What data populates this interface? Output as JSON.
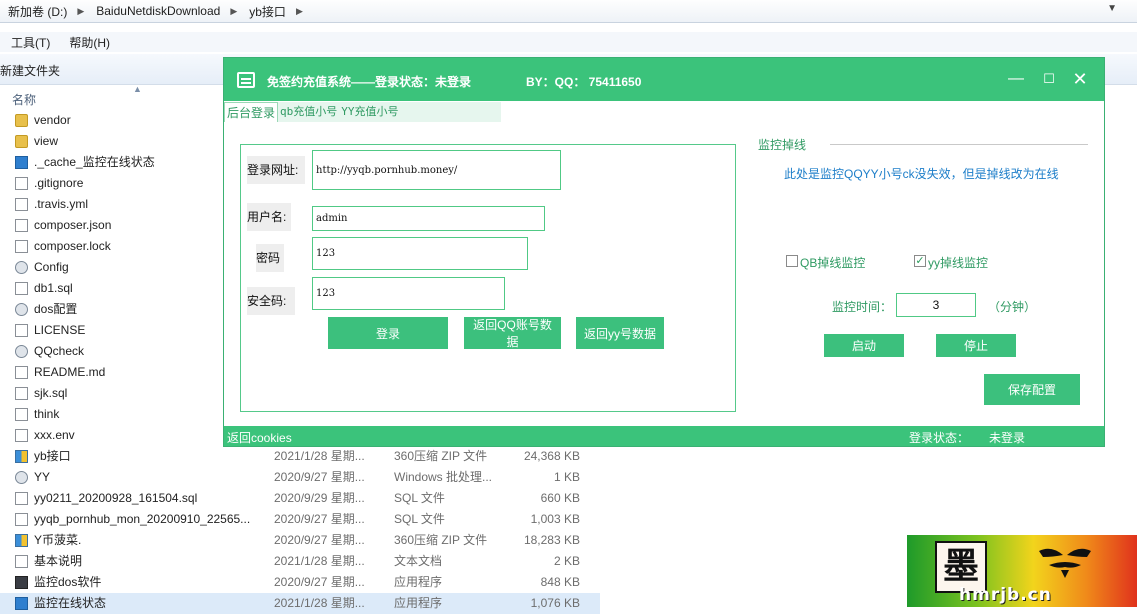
{
  "explorer": {
    "breadcrumbs": [
      "新加卷 (D:)",
      "BaiduNetdiskDownload",
      "yb接口"
    ],
    "menu": [
      "工具(T)",
      "帮助(H)"
    ],
    "toolbar_new_folder": "新建文件夹",
    "column_name": "名称",
    "files": [
      {
        "name": "vendor",
        "icon": "folder-icon"
      },
      {
        "name": "view",
        "icon": "folder-icon"
      },
      {
        "name": "._cache_监控在线状态",
        "icon": "app-icon"
      },
      {
        "name": ".gitignore",
        "icon": "file-icon"
      },
      {
        "name": ".travis.yml",
        "icon": "file-icon"
      },
      {
        "name": "composer.json",
        "icon": "file-icon"
      },
      {
        "name": "composer.lock",
        "icon": "file-icon"
      },
      {
        "name": "Config",
        "icon": "settings-file-icon"
      },
      {
        "name": "db1.sql",
        "icon": "file-icon"
      },
      {
        "name": "dos配置",
        "icon": "settings-file-icon"
      },
      {
        "name": "LICENSE",
        "icon": "file-icon"
      },
      {
        "name": "QQcheck",
        "icon": "settings-file-icon"
      },
      {
        "name": "README.md",
        "icon": "file-icon"
      },
      {
        "name": "sjk.sql",
        "icon": "file-icon"
      },
      {
        "name": "think",
        "icon": "file-icon"
      },
      {
        "name": "xxx.env",
        "icon": "file-icon"
      },
      {
        "name": "yb接口",
        "icon": "zip-icon",
        "date": "2021/1/28 星期...",
        "type": "360压缩 ZIP 文件",
        "size": "24,368 KB"
      },
      {
        "name": "YY",
        "icon": "settings-file-icon",
        "date": "2020/9/27 星期...",
        "type": "Windows 批处理...",
        "size": "1 KB"
      },
      {
        "name": "yy0211_20200928_161504.sql",
        "icon": "file-icon",
        "date": "2020/9/29 星期...",
        "type": "SQL 文件",
        "size": "660 KB"
      },
      {
        "name": "yyqb_pornhub_mon_20200910_22565...",
        "icon": "file-icon",
        "date": "2020/9/27 星期...",
        "type": "SQL 文件",
        "size": "1,003 KB"
      },
      {
        "name": "Y币菠菜.",
        "icon": "zip-icon",
        "date": "2020/9/27 星期...",
        "type": "360压缩 ZIP 文件",
        "size": "18,283 KB"
      },
      {
        "name": "基本说明",
        "icon": "file-icon",
        "date": "2021/1/28 星期...",
        "type": "文本文档",
        "size": "2 KB"
      },
      {
        "name": "监控dos软件",
        "icon": "bat-icon",
        "date": "2020/9/27 星期...",
        "type": "应用程序",
        "size": "848 KB"
      },
      {
        "name": "监控在线状态",
        "icon": "app-icon",
        "date": "2021/1/28 星期...",
        "type": "应用程序",
        "size": "1,076 KB"
      }
    ]
  },
  "app": {
    "title": "免签约充值系统——登录状态：未登录",
    "by": "BY：QQ： 75411650",
    "tabs": [
      "后台登录",
      "qb充值小号",
      "YY充值小号"
    ],
    "login": {
      "url_label": "登录网址:",
      "url_value": "http://yyqb.pornhub.money/",
      "user_label": "用户名:",
      "user_value": "admin",
      "pass_label": "密码",
      "pass_value": "123",
      "safe_label": "安全码:",
      "safe_value": "123",
      "login_btn": "登录",
      "qq_btn": "返回QQ账号数据",
      "yy_btn": "返回yy号数据"
    },
    "monitor": {
      "title": "监控掉线",
      "desc": "此处是监控QQYY小号ck没失效，但是掉线改为在线",
      "qb_label": "QB掉线监控",
      "qb_checked": false,
      "yy_label": "yy掉线监控",
      "yy_checked": true,
      "time_label": "监控时间：",
      "time_value": "3",
      "time_unit": "（分钟）",
      "start_btn": "启动",
      "stop_btn": "停止",
      "save_btn": "保存配置"
    },
    "status": {
      "back": "返回cookies",
      "label": "登录状态：",
      "value": "未登录"
    }
  },
  "watermark": {
    "seal_text": "墨",
    "site": "hmrjb.cn"
  }
}
